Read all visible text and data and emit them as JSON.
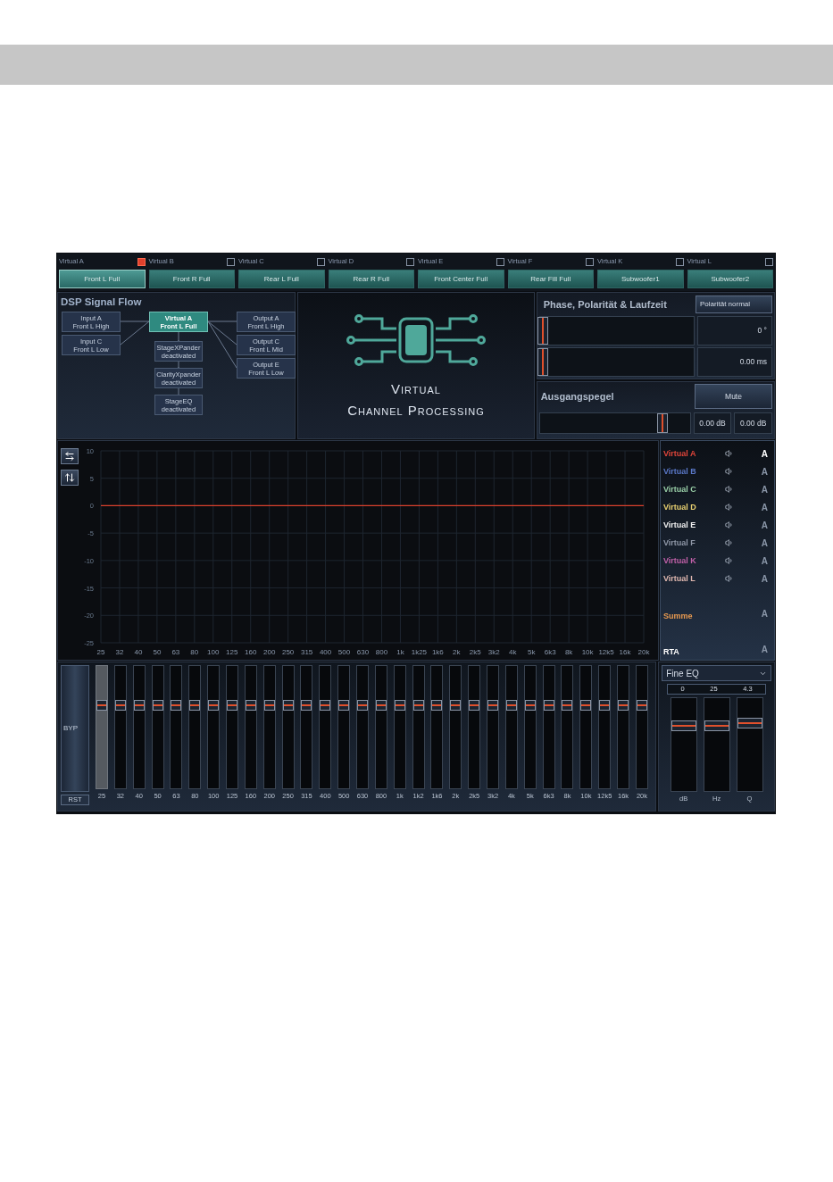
{
  "channels": [
    {
      "label": "Virtual A",
      "checked": true,
      "button": "Front L Full",
      "selected": true
    },
    {
      "label": "Virtual B",
      "checked": false,
      "button": "Front R Full",
      "selected": false
    },
    {
      "label": "Virtual C",
      "checked": false,
      "button": "Rear L Full",
      "selected": false
    },
    {
      "label": "Virtual D",
      "checked": false,
      "button": "Rear R Full",
      "selected": false
    },
    {
      "label": "Virtual E",
      "checked": false,
      "button": "Front Center Full",
      "selected": false
    },
    {
      "label": "Virtual F",
      "checked": false,
      "button": "Rear Fill Full",
      "selected": false
    },
    {
      "label": "Virtual K",
      "checked": false,
      "button": "Subwoofer1",
      "selected": false
    },
    {
      "label": "Virtual L",
      "checked": false,
      "button": "Subwoofer2",
      "selected": false
    }
  ],
  "signal_flow": {
    "title": "DSP Signal Flow",
    "inputs": [
      {
        "line1": "Input A",
        "line2": "Front L High"
      },
      {
        "line1": "Input C",
        "line2": "Front L Low"
      }
    ],
    "virtual": {
      "line1": "Virtual A",
      "line2": "Front L Full"
    },
    "processing": [
      {
        "line1": "StageXPander",
        "line2": "deactivated"
      },
      {
        "line1": "ClarityXpander",
        "line2": "deactivated"
      },
      {
        "line1": "StageEQ",
        "line2": "deactivated"
      }
    ],
    "outputs": [
      {
        "line1": "Output A",
        "line2": "Front L High"
      },
      {
        "line1": "Output C",
        "line2": "Front L Mid"
      },
      {
        "line1": "Output E",
        "line2": "Front L Low"
      }
    ]
  },
  "logo": {
    "title_lines": [
      "Virtual",
      "Channel Processing"
    ]
  },
  "phase_panel": {
    "title": "Phase, Polarität & Laufzeit",
    "polarity_button": "Polarität normal",
    "controls": [
      {
        "level": 0.02,
        "reading": "0 °"
      },
      {
        "level": 0.02,
        "reading": "0.00 ms"
      }
    ]
  },
  "output_level": {
    "title": "Ausgangspegel",
    "mute_button": "Mute",
    "level": 0.82,
    "readings": [
      "0.00 dB",
      "0.00 dB"
    ]
  },
  "graph": {
    "chart_data": {
      "type": "line",
      "categories": [
        "25",
        "32",
        "40",
        "50",
        "63",
        "80",
        "100",
        "125",
        "160",
        "200",
        "250",
        "315",
        "400",
        "500",
        "630",
        "800",
        "1k",
        "1k25",
        "1k6",
        "2k",
        "2k5",
        "3k2",
        "4k",
        "5k",
        "6k3",
        "8k",
        "10k",
        "12k5",
        "16k",
        "20k"
      ],
      "grid": true,
      "series": [
        {
          "color": "#d9402c",
          "values": [
            0,
            0,
            0,
            0,
            0,
            0,
            0,
            0,
            0,
            0,
            0,
            0,
            0,
            0,
            0,
            0,
            0,
            0,
            0,
            0,
            0,
            0,
            0,
            0,
            0,
            0,
            0,
            0,
            0,
            0
          ]
        }
      ],
      "ylim": [
        -25,
        10
      ],
      "yticks": [
        10,
        5,
        0,
        -5,
        -10,
        -15,
        -20,
        -25
      ]
    }
  },
  "legend": [
    {
      "kind": "channel",
      "name": "Virtual A",
      "color": "#e0453a",
      "letter": "A",
      "selected": true
    },
    {
      "kind": "channel",
      "name": "Virtual B",
      "color": "#5a78c8",
      "letter": "A",
      "selected": false
    },
    {
      "kind": "channel",
      "name": "Virtual C",
      "color": "#9ad0a8",
      "letter": "A",
      "selected": false
    },
    {
      "kind": "channel",
      "name": "Virtual D",
      "color": "#e8d070",
      "letter": "A",
      "selected": false
    },
    {
      "kind": "channel",
      "name": "Virtual E",
      "color": "#f0f0f0",
      "letter": "A",
      "selected": false
    },
    {
      "kind": "channel",
      "name": "Virtual F",
      "color": "#9098a8",
      "letter": "A",
      "selected": false
    },
    {
      "kind": "channel",
      "name": "Virtual K",
      "color": "#c060a8",
      "letter": "A",
      "selected": false
    },
    {
      "kind": "channel",
      "name": "Virtual L",
      "color": "#e0b8b0",
      "letter": "A",
      "selected": false
    },
    {
      "kind": "summary",
      "name": "Summe",
      "color": "#e89a50",
      "letter": "A",
      "selected": false
    },
    {
      "kind": "summary",
      "name": "RTA",
      "color": "#ffffff",
      "letter": "A",
      "selected": false
    }
  ],
  "eq": {
    "bypass_button": "BYP",
    "reset_button": "RST",
    "bands": [
      {
        "label": "25",
        "level": 0.68,
        "selected": true
      },
      {
        "label": "32",
        "level": 0.68,
        "selected": false
      },
      {
        "label": "40",
        "level": 0.68,
        "selected": false
      },
      {
        "label": "50",
        "level": 0.68,
        "selected": false
      },
      {
        "label": "63",
        "level": 0.68,
        "selected": false
      },
      {
        "label": "80",
        "level": 0.68,
        "selected": false
      },
      {
        "label": "100",
        "level": 0.68,
        "selected": false
      },
      {
        "label": "125",
        "level": 0.68,
        "selected": false
      },
      {
        "label": "160",
        "level": 0.68,
        "selected": false
      },
      {
        "label": "200",
        "level": 0.68,
        "selected": false
      },
      {
        "label": "250",
        "level": 0.68,
        "selected": false
      },
      {
        "label": "315",
        "level": 0.68,
        "selected": false
      },
      {
        "label": "400",
        "level": 0.68,
        "selected": false
      },
      {
        "label": "500",
        "level": 0.68,
        "selected": false
      },
      {
        "label": "630",
        "level": 0.68,
        "selected": false
      },
      {
        "label": "800",
        "level": 0.68,
        "selected": false
      },
      {
        "label": "1k",
        "level": 0.68,
        "selected": false
      },
      {
        "label": "1k2",
        "level": 0.68,
        "selected": false
      },
      {
        "label": "1k6",
        "level": 0.68,
        "selected": false
      },
      {
        "label": "2k",
        "level": 0.68,
        "selected": false
      },
      {
        "label": "2k5",
        "level": 0.68,
        "selected": false
      },
      {
        "label": "3k2",
        "level": 0.68,
        "selected": false
      },
      {
        "label": "4k",
        "level": 0.68,
        "selected": false
      },
      {
        "label": "5k",
        "level": 0.68,
        "selected": false
      },
      {
        "label": "6k3",
        "level": 0.68,
        "selected": false
      },
      {
        "label": "8k",
        "level": 0.68,
        "selected": false
      },
      {
        "label": "10k",
        "level": 0.68,
        "selected": false
      },
      {
        "label": "12k5",
        "level": 0.68,
        "selected": false
      },
      {
        "label": "16k",
        "level": 0.68,
        "selected": false
      },
      {
        "label": "20k",
        "level": 0.68,
        "selected": false
      }
    ]
  },
  "fine_eq": {
    "mode": "Fine EQ",
    "params": [
      {
        "reading": "0",
        "label": "dB",
        "level": 0.7
      },
      {
        "reading": "25",
        "label": "Hz",
        "level": 0.7
      },
      {
        "reading": "4.3",
        "label": "Q",
        "level": 0.73
      }
    ]
  }
}
